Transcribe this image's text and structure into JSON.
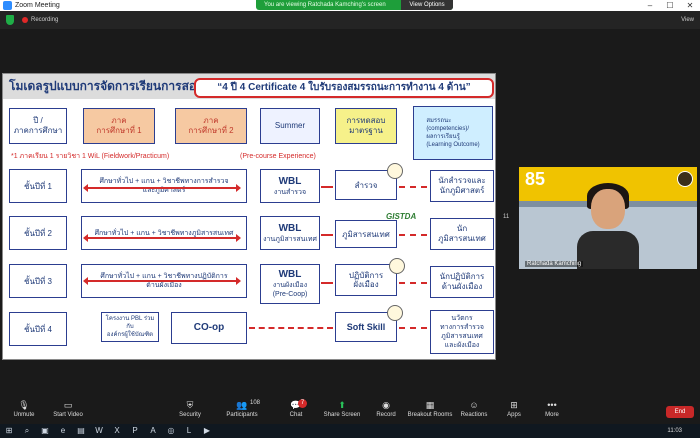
{
  "window": {
    "title": "Zoom Meeting"
  },
  "banner": {
    "viewing": "You are viewing Ratchada Kamching's screen",
    "view_options": "View Options"
  },
  "status": {
    "recording": "Recording",
    "view": "View"
  },
  "slide": {
    "title": "โมเดลรูปแบบการจัดการเรียนการสอน",
    "certificate": "“4 ปี 4 Certificate 4 ใบรับรองสมรรถนะการทำงาน 4 ด้าน”",
    "headers": {
      "year": "ปี /\nภาคการศึกษา",
      "term1": "ภาค\nการศึกษาที่ 1",
      "term2": "ภาค\nการศึกษาที่ 2",
      "summer": "Summer",
      "exam": "การทดสอบ\nมาตรฐาน",
      "outcome": "สมรรถนะ\n(competencies)/\nผลการเรียนรู้\n(Learning Outcome)"
    },
    "note_wil": "*1 ภาคเรียน 1 รายวิชา 1 WiL (Fieldwork/Practicum)",
    "note_pre": "(Pre-course Experience)",
    "rows": [
      {
        "year": "ชั้นปีที่ 1",
        "study": "ศึกษาทั่วไป + แกน + วิชาชีพทางการสำรวจ\nและภูมิศาสตร์",
        "wbl": "WBL",
        "wbl_sub": "งานสำรวจ",
        "skill": "สำรวจ",
        "outcome": "นักสำรวจและ\nนักภูมิศาสตร์"
      },
      {
        "year": "ชั้นปีที่ 2",
        "study": "ศึกษาทั่วไป + แกน + วิชาชีพทางภูมิสารสนเทศ",
        "wbl": "WBL",
        "wbl_sub": "งานภูมิสารสนเทศ",
        "skill": "ภูมิสารสนเทศ",
        "outcome": "นัก\nภูมิสารสนเทศ"
      },
      {
        "year": "ชั้นปีที่ 3",
        "study": "ศึกษาทั่วไป + แกน + วิชาชีพทางปฏิบัติการ\nด้านผังเมือง",
        "wbl": "WBL",
        "wbl_sub": "งานผังเมือง\n(Pre-Coop)",
        "skill": "ปฏิบัติการ\nผังเมือง",
        "outcome": "นักปฏิบัติการ\nด้านผังเมือง"
      },
      {
        "year": "ชั้นปีที่ 4",
        "study": "โครงงาน PBL ร่วมกับ\nองค์กรผู้ใช้บัณฑิต",
        "wbl": "CO-op",
        "wbl_sub": "",
        "skill": "Soft Skill",
        "outcome": "นวัตกร\nทางการสำรวจ\nภูมิสารสนเทศ\nและผังเมือง"
      }
    ],
    "gistda": "GISTDA",
    "page_indicator": "11"
  },
  "video": {
    "name": "Ratchada Kamching",
    "sign_text": "85"
  },
  "toolbar": {
    "unmute": "Unmute",
    "start_video": "Start Video",
    "security": "Security",
    "participants": "Participants",
    "participants_count": "108",
    "chat": "Chat",
    "chat_badge": "7",
    "share_screen": "Share Screen",
    "record": "Record",
    "breakout": "Breakout Rooms",
    "reactions": "Reactions",
    "apps": "Apps",
    "more": "More",
    "end": "End"
  },
  "taskbar": {
    "time": "11:03"
  },
  "colors": {
    "banner": "#1e9e3a",
    "end": "#c82828",
    "share": "#29c25a",
    "slide_title": "#1f3a78",
    "accent_red": "#d42a2a"
  }
}
